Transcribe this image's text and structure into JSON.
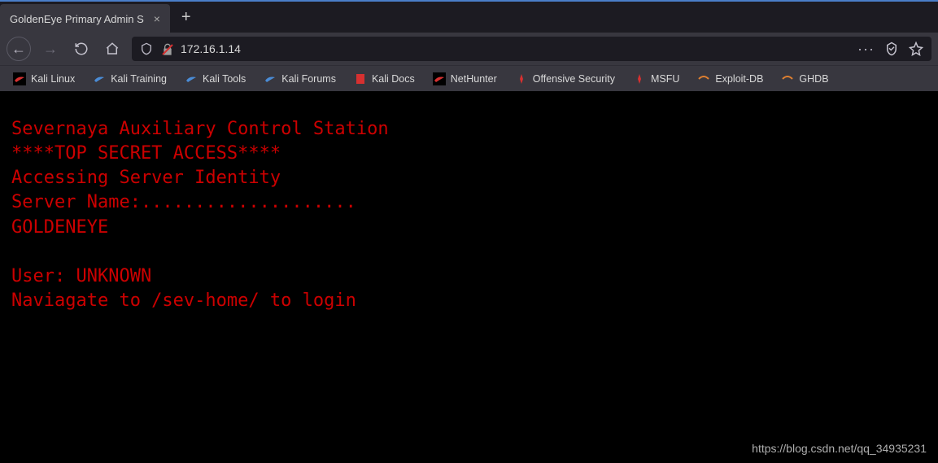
{
  "tab": {
    "title": "GoldenEye Primary Admin S",
    "close_glyph": "×"
  },
  "new_tab_glyph": "+",
  "nav": {
    "back_glyph": "←",
    "forward_glyph": "→",
    "home_glyph": "⌂"
  },
  "url": {
    "text": "172.16.1.14",
    "dots_glyph": "···"
  },
  "bookmarks": [
    {
      "label": "Kali Linux",
      "icon": "kali"
    },
    {
      "label": "Kali Training",
      "icon": "kali-blue"
    },
    {
      "label": "Kali Tools",
      "icon": "kali-blue"
    },
    {
      "label": "Kali Forums",
      "icon": "kali-blue"
    },
    {
      "label": "Kali Docs",
      "icon": "doc-red"
    },
    {
      "label": "NetHunter",
      "icon": "kali"
    },
    {
      "label": "Offensive Security",
      "icon": "offsec"
    },
    {
      "label": "MSFU",
      "icon": "offsec"
    },
    {
      "label": "Exploit-DB",
      "icon": "exploit"
    },
    {
      "label": "GHDB",
      "icon": "exploit"
    }
  ],
  "content": {
    "line1": "Severnaya Auxiliary Control Station",
    "line2": "****TOP SECRET ACCESS****",
    "line3": "Accessing Server Identity",
    "line4": "Server Name:....................",
    "line5": "GOLDENEYE",
    "blank": "",
    "line6": "User: UNKNOWN",
    "line7": "Naviagate to /sev-home/ to login"
  },
  "watermark": "https://blog.csdn.net/qq_34935231"
}
